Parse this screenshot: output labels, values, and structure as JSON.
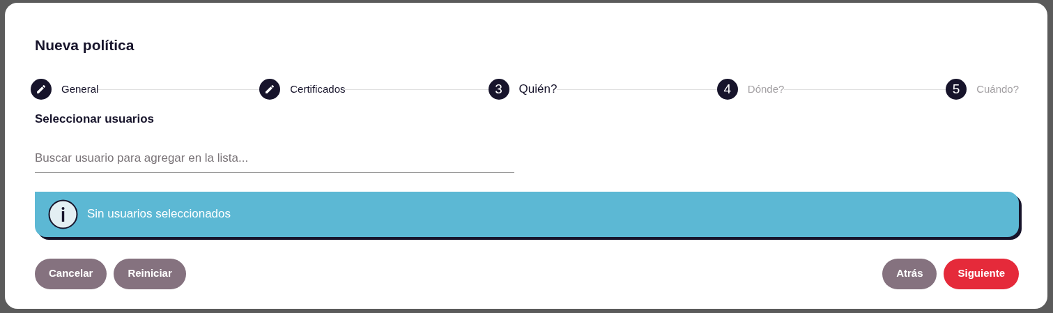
{
  "dialog": {
    "title": "Nueva política"
  },
  "steps": [
    {
      "label": "General",
      "completed": true,
      "selected": false
    },
    {
      "label": "Certificados",
      "completed": true,
      "selected": false
    },
    {
      "label": "Quién?",
      "number": "3",
      "completed": false,
      "selected": true
    },
    {
      "label": "Dónde?",
      "number": "4",
      "completed": false,
      "selected": false
    },
    {
      "label": "Cuándo?",
      "number": "5",
      "completed": false,
      "selected": false
    }
  ],
  "section_title": "Seleccionar usuarios",
  "search": {
    "placeholder": "Buscar usuario para agregar en la lista..."
  },
  "alert": {
    "text": "Sin usuarios seleccionados"
  },
  "buttons_left": [
    {
      "label": "Cancelar",
      "primary": false
    },
    {
      "label": "Reiniciar",
      "primary": false
    }
  ],
  "buttons_right": [
    {
      "label": "Atrás",
      "primary": false
    },
    {
      "label": "Siguiente",
      "primary": true
    }
  ]
}
